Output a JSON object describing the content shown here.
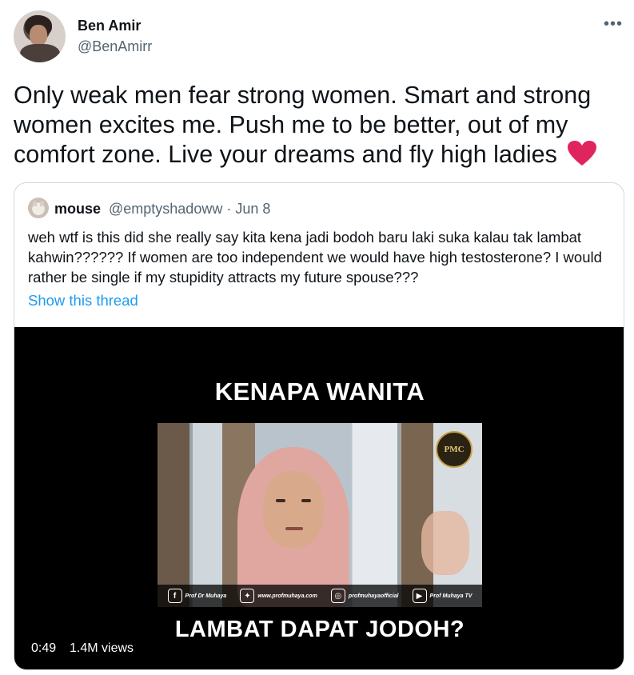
{
  "tweet": {
    "author_name": "Ben Amir",
    "author_handle": "@BenAmirr",
    "more_label": "•••",
    "text": "Only weak men fear strong women. Smart and strong women excites me. Push me to be better, out of my comfort zone. Live your dreams and fly high ladies",
    "emoji": "red-heart-icon"
  },
  "quote": {
    "author_name": "mouse",
    "meta": "@emptyshadoww · Jun 8",
    "text": "weh wtf is this did she really say kita kena jadi bodoh baru laki suka kalau tak lambat kahwin?????? If women are too independent we would have high testosterone? I would rather be single if my stupidity attracts my future spouse???",
    "show_thread": "Show this thread"
  },
  "video": {
    "title_top": "KENAPA WANITA",
    "title_bottom": "LAMBAT DAPAT JODOH?",
    "badge": "PMC",
    "time": "0:49",
    "views": "1.4M views",
    "socials": [
      {
        "icon": "f",
        "label": "Prof Dr Muhaya"
      },
      {
        "icon": "✦",
        "label": "www.profmuhaya.com"
      },
      {
        "icon": "◎",
        "label": "profmuhayaofficial"
      },
      {
        "icon": "▶",
        "label": "Prof Muhaya TV"
      }
    ]
  },
  "colors": {
    "text": "#0f1419",
    "secondary": "#536471",
    "link": "#1d9bf0",
    "border": "#cfd9de",
    "heart": "#e0245e"
  }
}
